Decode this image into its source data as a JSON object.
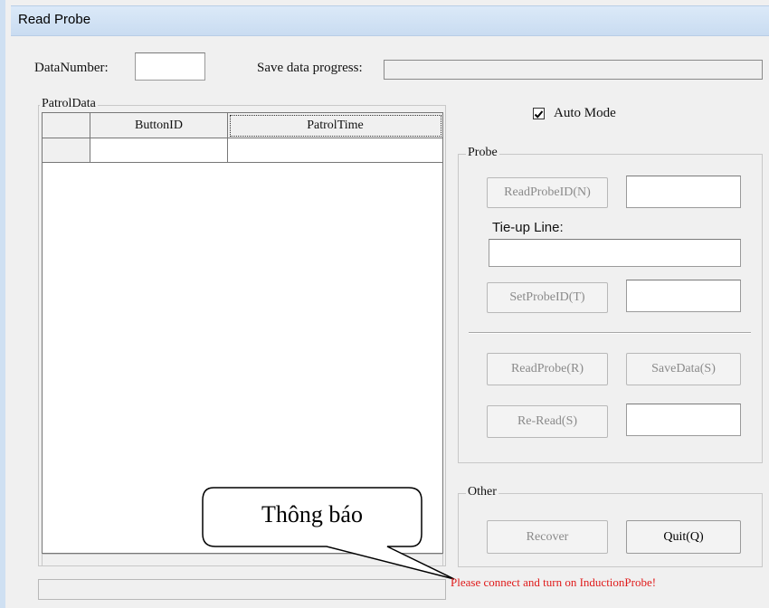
{
  "window": {
    "title": "Read Probe"
  },
  "header": {
    "data_number_label": "DataNumber:",
    "data_number_value": "",
    "save_progress_label": "Save data progress:",
    "save_progress_value": 0
  },
  "patrol": {
    "group_label": "PatrolData",
    "columns": [
      "",
      "ButtonID",
      "PatrolTime"
    ],
    "rows": [
      [
        "",
        "",
        ""
      ]
    ]
  },
  "auto_mode": {
    "label": "Auto Mode",
    "checked": true
  },
  "probe": {
    "group_label": "Probe",
    "read_probe_id_label": "ReadProbeID(N)",
    "read_probe_id_value": "",
    "tie_up_label": "Tie-up Line:",
    "tie_up_value": "",
    "set_probe_id_label": "SetProbeID(T)",
    "set_probe_id_value": "",
    "read_probe_label": "ReadProbe(R)",
    "save_data_label": "SaveData(S)",
    "re_read_label": "Re-Read(S)",
    "re_read_value": ""
  },
  "other": {
    "group_label": "Other",
    "recover_label": "Recover",
    "quit_label": "Quit(Q)"
  },
  "callout": {
    "text": "Thông báo"
  },
  "status": {
    "message": "Please connect and turn on InductionProbe!"
  }
}
